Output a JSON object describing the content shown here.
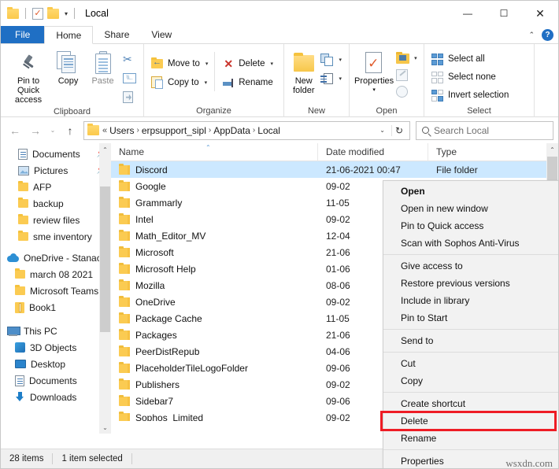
{
  "window": {
    "title": "Local",
    "quick_access": {
      "folder_icon": "folder-icon",
      "properties_icon": "properties-icon",
      "new_folder_icon": "new-folder-icon",
      "customize_caret": "▾"
    },
    "controls": {
      "minimize": "—",
      "maximize": "❐",
      "close": "✕"
    }
  },
  "tabs": [
    {
      "label": "File",
      "kind": "file"
    },
    {
      "label": "Home",
      "kind": "active"
    },
    {
      "label": "Share",
      "kind": "normal"
    },
    {
      "label": "View",
      "kind": "normal"
    }
  ],
  "tab_right": {
    "collapse_caret": "⌃",
    "help": "?"
  },
  "ribbon": {
    "groups": [
      {
        "label": "Clipboard",
        "big": [
          {
            "label": "Pin to Quick\naccess",
            "line1": "Pin to Quick",
            "line2": "access",
            "icon": "pin-icon"
          },
          {
            "label": "Copy",
            "line1": "Copy",
            "line2": "",
            "icon": "copy-icon"
          },
          {
            "label": "Paste",
            "line1": "Paste",
            "line2": "",
            "icon": "paste-icon"
          }
        ],
        "small": [
          {
            "label": "",
            "icon": "cut-icon"
          },
          {
            "label": "",
            "icon": "copy-path-icon"
          },
          {
            "label": "",
            "icon": "paste-shortcut-icon"
          }
        ]
      },
      {
        "label": "Organize",
        "items": [
          {
            "label": "Move to",
            "icon": "move-to-icon",
            "caret": "▾"
          },
          {
            "label": "Copy to",
            "icon": "copy-to-icon",
            "caret": "▾"
          },
          {
            "label": "Delete",
            "icon": "delete-icon",
            "caret": "▾"
          },
          {
            "label": "Rename",
            "icon": "rename-icon",
            "caret": ""
          }
        ]
      },
      {
        "label": "New",
        "big": [
          {
            "line1": "New",
            "line2": "folder",
            "icon": "new-folder-icon"
          }
        ],
        "small": [
          {
            "label": "",
            "icon": "new-item-icon",
            "caret": "▾"
          },
          {
            "label": "",
            "icon": "easy-access-icon",
            "caret": "▾"
          }
        ]
      },
      {
        "label": "Open",
        "big": [
          {
            "line1": "Properties",
            "line2": "▾",
            "icon": "properties-icon"
          }
        ],
        "small": [
          {
            "label": "",
            "icon": "open-with-icon",
            "caret": "▾"
          },
          {
            "label": "",
            "icon": "edit-icon",
            "caret": ""
          },
          {
            "label": "",
            "icon": "history-icon",
            "caret": ""
          }
        ]
      },
      {
        "label": "Select",
        "items": [
          {
            "label": "Select all",
            "icon": "select-all-icon"
          },
          {
            "label": "Select none",
            "icon": "select-none-icon"
          },
          {
            "label": "Invert selection",
            "icon": "invert-selection-icon"
          }
        ]
      }
    ]
  },
  "addressbar": {
    "back": "←",
    "forward": "→",
    "recent_caret": "⌄",
    "up": "↑",
    "folder_icon": "folder-icon",
    "lead": "«",
    "crumbs": [
      "Users",
      "erpsupport_sipl",
      "AppData",
      "Local"
    ],
    "separator": "›",
    "dropdown_caret": "⌄",
    "refresh": "↻",
    "search": {
      "placeholder": "Search Local",
      "icon": "search-icon"
    }
  },
  "sidebar": {
    "items": [
      {
        "label": "Documents",
        "icon": "documents-icon",
        "indent": 1,
        "pinned": "📌"
      },
      {
        "label": "Pictures",
        "icon": "pictures-icon",
        "indent": 1,
        "pinned": "📌"
      },
      {
        "label": "AFP",
        "icon": "folder-icon",
        "indent": 1,
        "pinned": ""
      },
      {
        "label": "backup",
        "icon": "folder-icon",
        "indent": 1,
        "pinned": ""
      },
      {
        "label": "review files",
        "icon": "folder-icon",
        "indent": 1,
        "pinned": ""
      },
      {
        "label": "sme inventory",
        "icon": "folder-icon",
        "indent": 1,
        "pinned": ""
      },
      {
        "label": "OneDrive - Stanac",
        "icon": "onedrive-icon",
        "indent": 0,
        "pinned": ""
      },
      {
        "label": "march 08 2021",
        "icon": "folder-icon",
        "indent": 1,
        "pinned": ""
      },
      {
        "label": "Microsoft Teams",
        "icon": "folder-icon",
        "indent": 1,
        "pinned": ""
      },
      {
        "label": "Book1",
        "icon": "zip-icon",
        "indent": 1,
        "pinned": ""
      },
      {
        "label": "This PC",
        "icon": "this-pc-icon",
        "indent": 0,
        "pinned": ""
      },
      {
        "label": "3D Objects",
        "icon": "3d-objects-icon",
        "indent": 1,
        "pinned": ""
      },
      {
        "label": "Desktop",
        "icon": "desktop-icon",
        "indent": 1,
        "pinned": ""
      },
      {
        "label": "Documents",
        "icon": "documents-icon",
        "indent": 1,
        "pinned": ""
      },
      {
        "label": "Downloads",
        "icon": "downloads-icon",
        "indent": 1,
        "pinned": ""
      }
    ],
    "scroll": {
      "up": "⌃",
      "down": "⌄"
    }
  },
  "filelist": {
    "columns": [
      "Name",
      "Date modified",
      "Type"
    ],
    "sort_indicator": "⌃",
    "rows": [
      {
        "name": "Discord",
        "date": "21-06-2021 00:47",
        "type": "File folder",
        "selected": true
      },
      {
        "name": "Google",
        "date": "09-02",
        "type": "",
        "selected": false
      },
      {
        "name": "Grammarly",
        "date": "11-05",
        "type": "",
        "selected": false
      },
      {
        "name": "Intel",
        "date": "09-02",
        "type": "",
        "selected": false
      },
      {
        "name": "Math_Editor_MV",
        "date": "12-04",
        "type": "",
        "selected": false
      },
      {
        "name": "Microsoft",
        "date": "21-06",
        "type": "",
        "selected": false
      },
      {
        "name": "Microsoft Help",
        "date": "01-06",
        "type": "",
        "selected": false
      },
      {
        "name": "Mozilla",
        "date": "08-06",
        "type": "",
        "selected": false
      },
      {
        "name": "OneDrive",
        "date": "09-02",
        "type": "",
        "selected": false
      },
      {
        "name": "Package Cache",
        "date": "11-05",
        "type": "",
        "selected": false
      },
      {
        "name": "Packages",
        "date": "21-06",
        "type": "",
        "selected": false
      },
      {
        "name": "PeerDistRepub",
        "date": "04-06",
        "type": "",
        "selected": false
      },
      {
        "name": "PlaceholderTileLogoFolder",
        "date": "09-06",
        "type": "",
        "selected": false
      },
      {
        "name": "Publishers",
        "date": "09-02",
        "type": "",
        "selected": false
      },
      {
        "name": "Sidebar7",
        "date": "09-06",
        "type": "",
        "selected": false
      },
      {
        "name": "Sophos_Limited",
        "date": "09-02",
        "type": "",
        "selected": false
      }
    ],
    "scroll": {
      "up": "⌃",
      "down": "⌄"
    }
  },
  "context_menu": {
    "groups": [
      [
        {
          "label": "Open",
          "bold": true
        },
        {
          "label": "Open in new window",
          "bold": false
        },
        {
          "label": "Pin to Quick access",
          "bold": false
        },
        {
          "label": "Scan with Sophos Anti-Virus",
          "bold": false
        }
      ],
      [
        {
          "label": "Give access to",
          "bold": false
        },
        {
          "label": "Restore previous versions",
          "bold": false
        },
        {
          "label": "Include in library",
          "bold": false
        },
        {
          "label": "Pin to Start",
          "bold": false
        }
      ],
      [
        {
          "label": "Send to",
          "bold": false
        }
      ],
      [
        {
          "label": "Cut",
          "bold": false
        },
        {
          "label": "Copy",
          "bold": false
        }
      ],
      [
        {
          "label": "Create shortcut",
          "bold": false
        },
        {
          "label": "Delete",
          "bold": false,
          "highlighted": true
        },
        {
          "label": "Rename",
          "bold": false
        }
      ],
      [
        {
          "label": "Properties",
          "bold": false
        }
      ]
    ],
    "highlight_color": "#ee1c25",
    "highlighted_item": "Delete"
  },
  "watermark": "wsxdn.com",
  "statusbar": {
    "item_count": "28 items",
    "selection": "1 item selected"
  },
  "colors": {
    "accent": "#1f6fc4",
    "selection": "#cce8ff",
    "highlight_red": "#ee1c25",
    "folder_yellow": "#fbcb52"
  }
}
